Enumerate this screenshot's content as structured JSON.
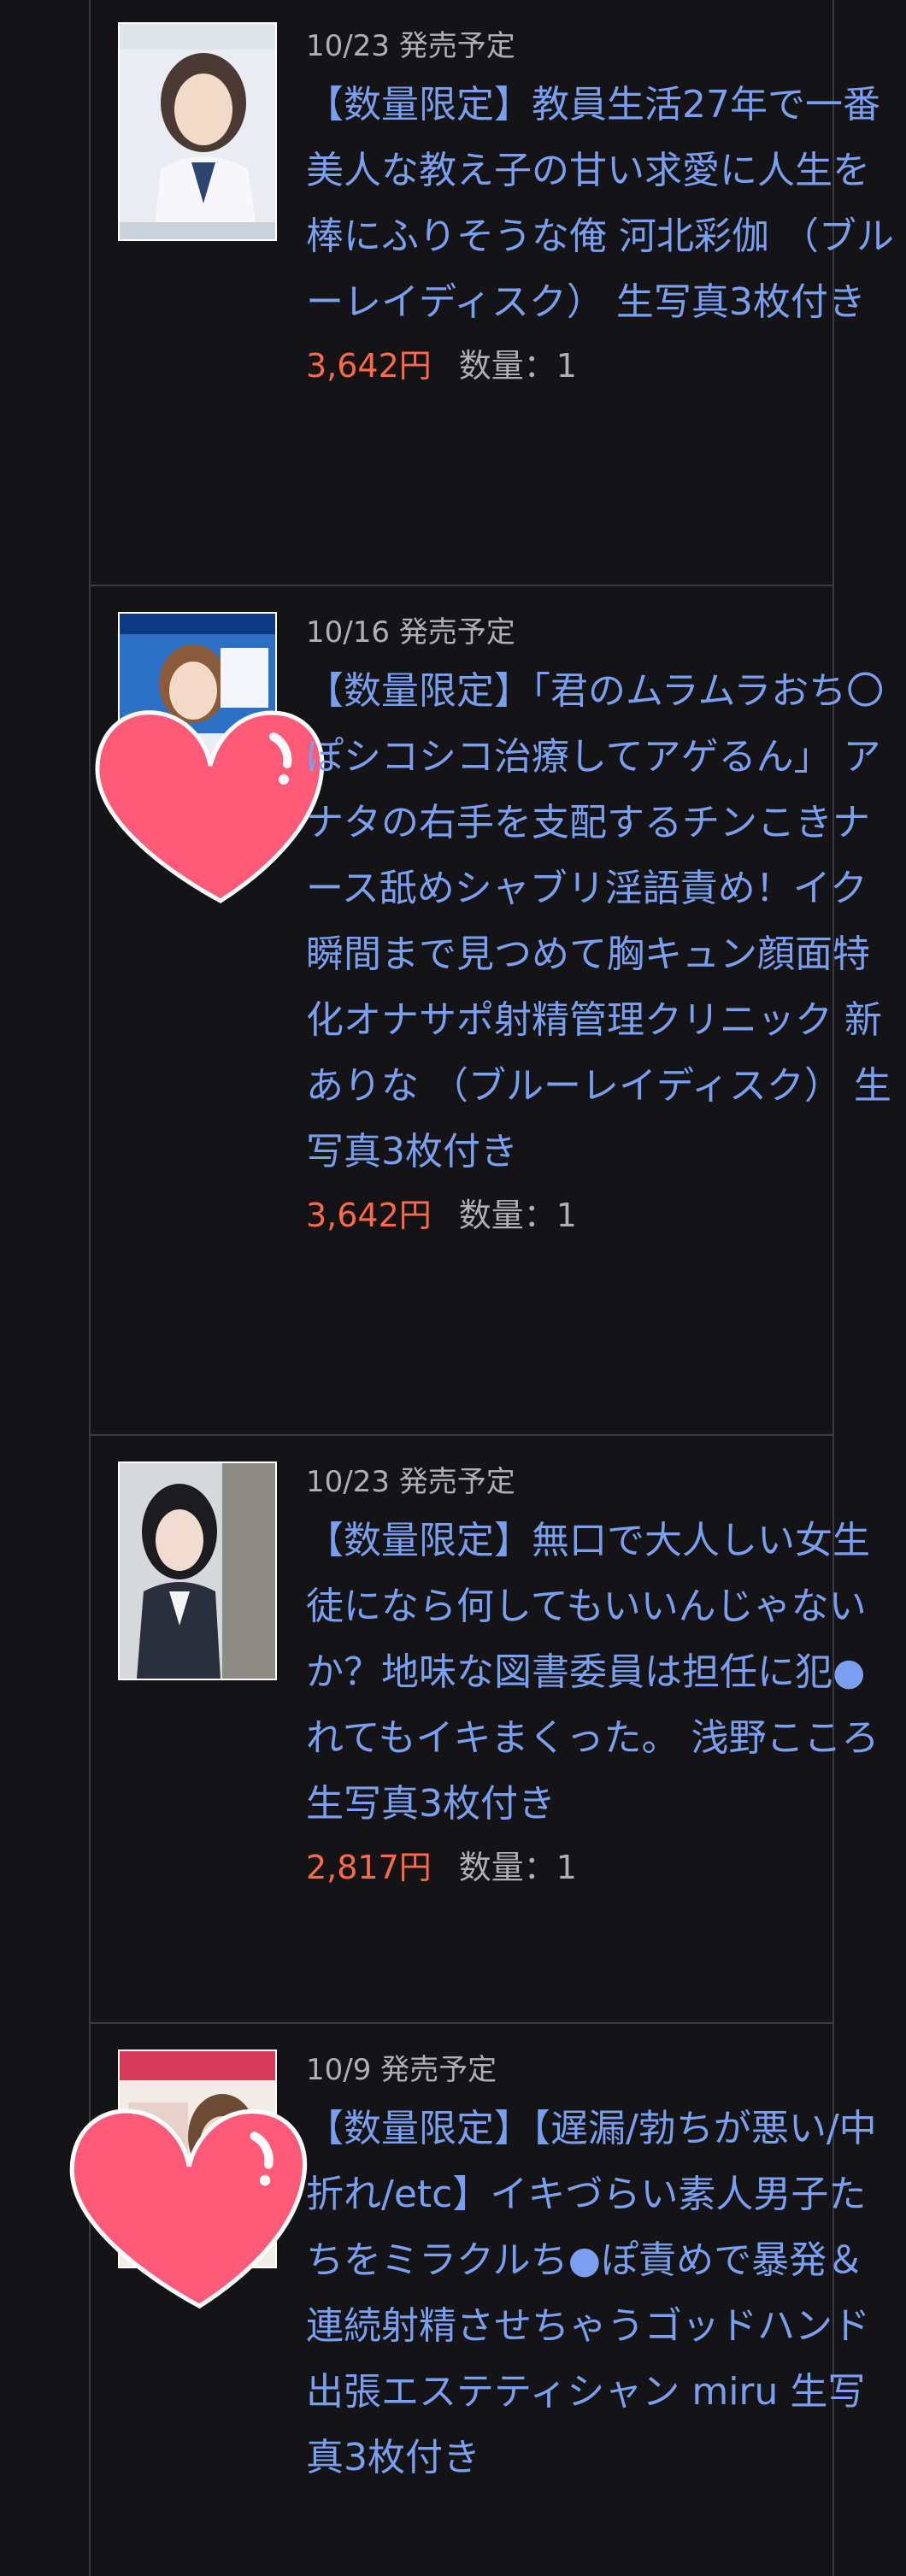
{
  "items": [
    {
      "date": "10/23",
      "status": "発売予定",
      "title": "【数量限定】教員生活27年で一番美人な教え子の甘い求愛に人生を棒にふりそうな俺 河北彩伽 （ブルーレイディスク） 生写真3枚付き",
      "price": "3,642円",
      "qty_label": "数量：1"
    },
    {
      "date": "10/16",
      "status": "発売予定",
      "title": "【数量限定】「君のムラムラおち〇ぽシコシコ治療してアゲるん」 アナタの右手を支配するチンこきナース舐めシャブリ淫語責め！イク瞬間まで見つめて胸キュン顔面特化オナサポ射精管理クリニック 新ありな （ブルーレイディスク） 生写真3枚付き",
      "price": "3,642円",
      "qty_label": "数量：1"
    },
    {
      "date": "10/23",
      "status": "発売予定",
      "title": "【数量限定】無口で大人しい女生徒になら何してもいいんじゃないか？地味な図書委員は担任に犯●れてもイキまくった。 浅野こころ 生写真3枚付き",
      "price": "2,817円",
      "qty_label": "数量：1"
    },
    {
      "date": "10/9",
      "status": "発売予定",
      "title": "【数量限定】【遅漏/勃ちが悪い/中折れ/etc】イキづらい素人男子たちをミラクルち●ぽ責めで暴発＆連続射精させちゃうゴッドハンド出張エステティシャン miru 生写真3枚付き",
      "price": "",
      "qty_label": ""
    }
  ],
  "colors": {
    "background": "#141416",
    "title": "#7b9ff0",
    "price": "#ff6a4c",
    "muted": "#b0b0b3",
    "heart": "#ff5a78"
  },
  "icons": [
    "heart-sticker-icon"
  ]
}
